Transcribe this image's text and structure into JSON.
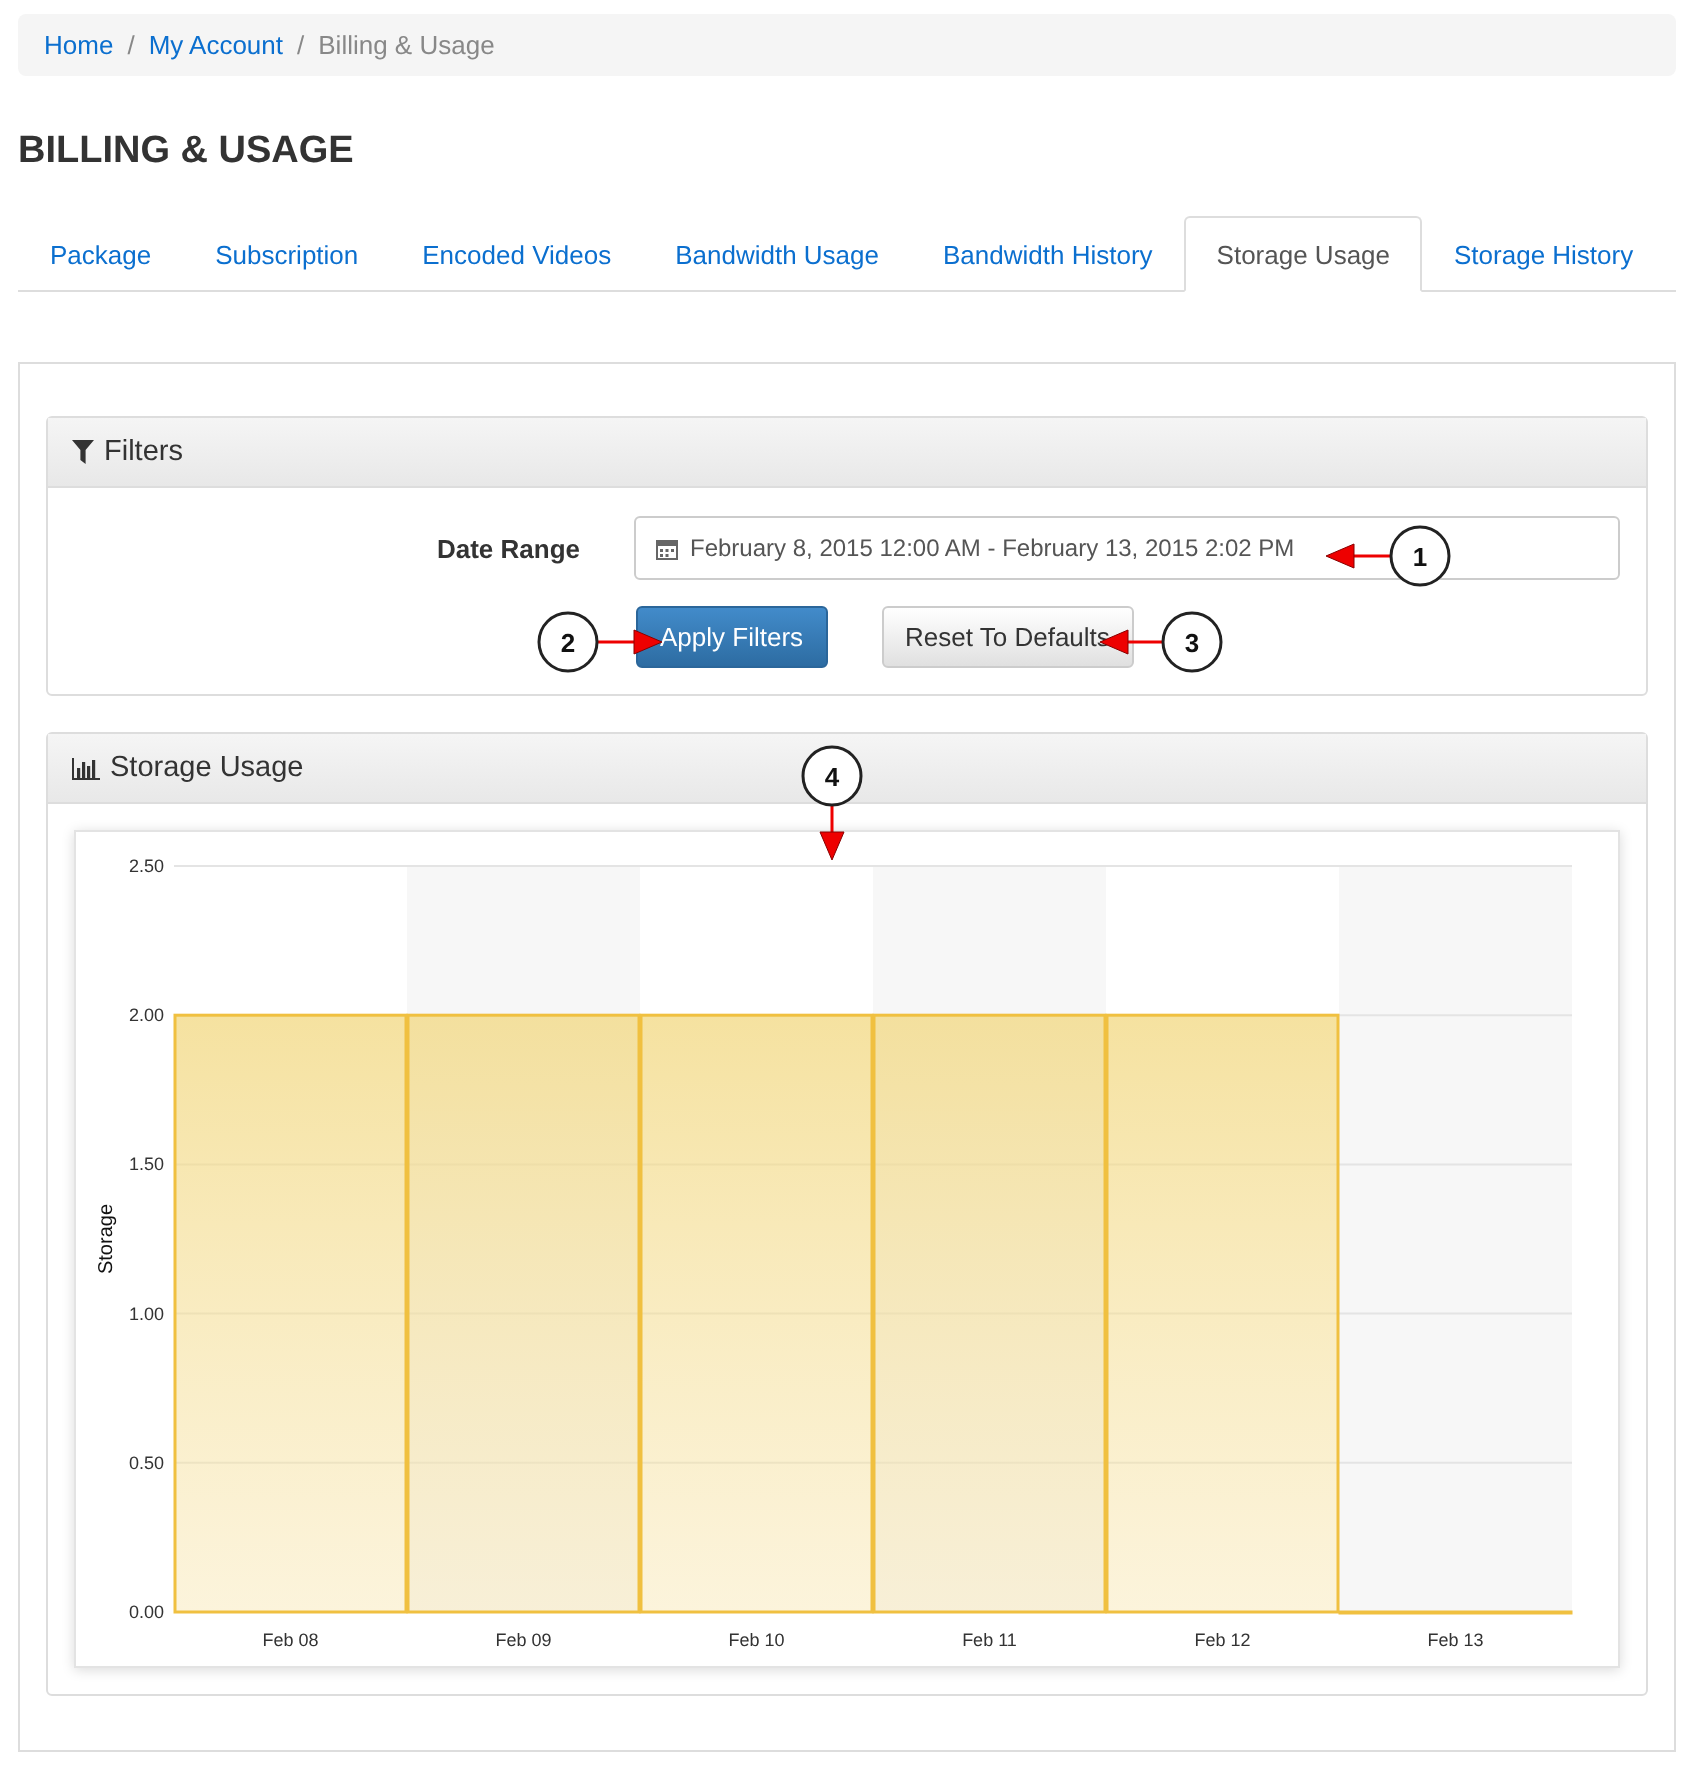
{
  "breadcrumb_separator": "/",
  "breadcrumb": [
    {
      "label": "Home",
      "current": false
    },
    {
      "label": "My Account",
      "current": false
    },
    {
      "label": "Billing & Usage",
      "current": true
    }
  ],
  "title": "BILLING & USAGE",
  "tabs": [
    {
      "label": "Package",
      "selected": false
    },
    {
      "label": "Subscription",
      "selected": false
    },
    {
      "label": "Encoded Videos",
      "selected": false
    },
    {
      "label": "Bandwidth Usage",
      "selected": false
    },
    {
      "label": "Bandwidth History",
      "selected": false
    },
    {
      "label": "Storage Usage",
      "selected": true
    },
    {
      "label": "Storage History",
      "selected": false
    }
  ],
  "filters": {
    "title": "Filters",
    "date_range_label": "Date Range",
    "date_range_value": "February 8, 2015 12:00 AM - February 13, 2015 2:02 PM",
    "apply_button": "Apply Filters",
    "reset_button": "Reset To Defaults"
  },
  "storage_panel": {
    "title": "Storage Usage",
    "chart_data": {
      "type": "bar",
      "grid": true,
      "ylabel": "Storage",
      "categories": [
        "Feb 08",
        "Feb 09",
        "Feb 10",
        "Feb 11",
        "Feb 12",
        "Feb 13"
      ],
      "values": [
        2,
        2,
        2,
        2,
        2,
        0
      ],
      "ylim": [
        0,
        2.5
      ],
      "yticks": [
        {
          "value": 0,
          "label": "0.00"
        },
        {
          "value": 0.5,
          "label": "0.50"
        },
        {
          "value": 1,
          "label": "1.00"
        },
        {
          "value": 1.5,
          "label": "1.50"
        },
        {
          "value": 2,
          "label": "2.00"
        },
        {
          "value": 2.5,
          "label": "2.50"
        }
      ]
    }
  },
  "callouts": [
    {
      "number": "1"
    },
    {
      "number": "2"
    },
    {
      "number": "3"
    },
    {
      "number": "4"
    }
  ]
}
